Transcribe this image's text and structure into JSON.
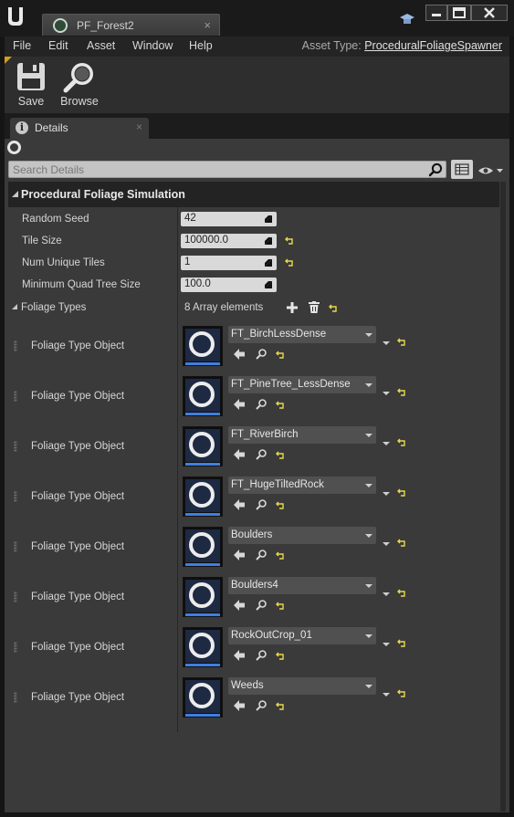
{
  "window": {
    "tab_title": "PF_Forest2",
    "tab_close": "×",
    "minimize": "–",
    "maximize": "□",
    "close": "✕"
  },
  "menu": {
    "items": [
      "File",
      "Edit",
      "Asset",
      "Window",
      "Help"
    ],
    "asset_type_label": "Asset Type:",
    "asset_type_value": "ProceduralFoliageSpawner"
  },
  "toolbar": {
    "save_label": "Save",
    "browse_label": "Browse"
  },
  "panel": {
    "tab_label": "Details",
    "tab_close": "×",
    "info_glyph": "i",
    "search_placeholder": "Search Details"
  },
  "category": {
    "title": "Procedural Foliage Simulation"
  },
  "properties": [
    {
      "label": "Random Seed",
      "value": "42",
      "resettable": false
    },
    {
      "label": "Tile Size",
      "value": "100000.0",
      "resettable": true
    },
    {
      "label": "Num Unique Tiles",
      "value": "1",
      "resettable": true
    },
    {
      "label": "Minimum Quad Tree Size",
      "value": "100.0",
      "resettable": false
    }
  ],
  "foliage_types": {
    "label": "Foliage Types",
    "count_text": "8 Array elements",
    "element_label": "Foliage Type Object",
    "elements": [
      "FT_BirchLessDense",
      "FT_PineTree_LessDense",
      "FT_RiverBirch",
      "FT_HugeTiltedRock",
      "Boulders",
      "Boulders4",
      "RockOutCrop_01",
      "Weeds"
    ]
  },
  "colors": {
    "accent_blue": "#3f7fe0",
    "reset_yellow": "#e8d84a",
    "panel_bg": "#3a3a3a",
    "chrome_bg": "#151515"
  }
}
